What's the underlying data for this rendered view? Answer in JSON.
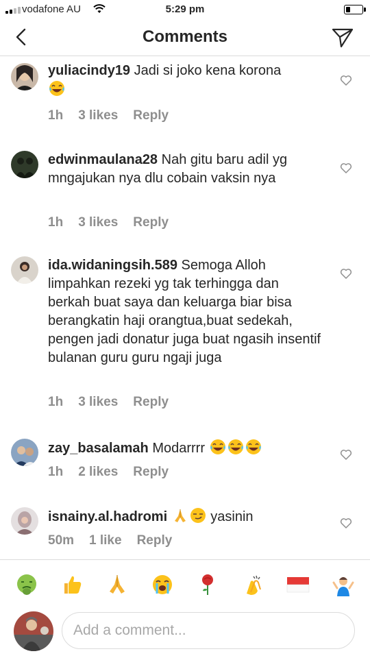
{
  "status_bar": {
    "carrier": "vodafone AU",
    "time": "5:29 pm",
    "battery_level": 0.3
  },
  "header": {
    "title": "Comments",
    "back_icon": "chevron-left-icon",
    "send_icon": "paper-plane-icon"
  },
  "comments": [
    {
      "username": "yuliacindy19",
      "text": "Jadi si joko kena korona",
      "emojis": [
        "tears-of-joy"
      ],
      "time": "1h",
      "likes": "3 likes",
      "reply": "Reply"
    },
    {
      "username": "edwinmaulana28",
      "text": "Nah gitu baru adil yg mngajukan nya dlu cobain vaksin nya",
      "emojis": [],
      "time": "1h",
      "likes": "3 likes",
      "reply": "Reply"
    },
    {
      "username": "ida.widaningsih.589",
      "text": "Semoga Alloh limpahkan rezeki yg tak terhingga dan berkah buat saya dan keluarga biar bisa berangkatin haji orangtua,buat sedekah, pengen jadi donatur juga buat ngasih insentif bulanan guru guru ngaji juga",
      "emojis": [],
      "time": "1h",
      "likes": "3 likes",
      "reply": "Reply"
    },
    {
      "username": "zay_basalamah",
      "text": "Modarrrr",
      "emojis": [
        "tears-of-joy",
        "tears-of-joy",
        "tears-of-joy"
      ],
      "time": "1h",
      "likes": "2 likes",
      "reply": "Reply"
    },
    {
      "username": "isnainy.al.hadromi",
      "text_before": "",
      "emojis": [
        "folded-hands",
        "smirk"
      ],
      "text": "yasinin",
      "time": "50m",
      "likes": "1 like",
      "reply": "Reply"
    }
  ],
  "emoji_bar": [
    "nauseated-face",
    "thumbs-up",
    "folded-hands",
    "loudly-crying-face",
    "rose",
    "clapping-hands",
    "flag-indonesia",
    "person-shrugging"
  ],
  "input": {
    "placeholder": "Add a comment..."
  }
}
